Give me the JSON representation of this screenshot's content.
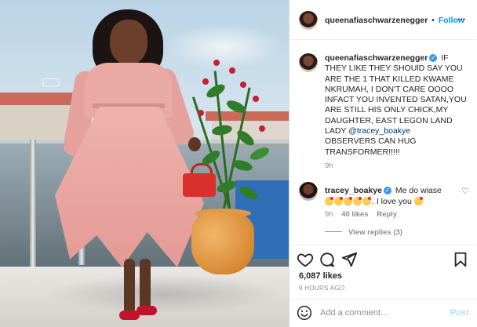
{
  "post": {
    "username": "queenafiaschwarzenegger",
    "separator": "•",
    "follow_label": "Follow",
    "more_label": "···"
  },
  "caption": {
    "username": "queenafiaschwarzenegger",
    "text_1": "IF THEY LIKE THEY SHOUlD SAY YOU ARE THE 1 THAT KILLED KWAME NKRUMAH, I DON'T CARE OOOO INFACT YOU INVENTED SATAN,YOU ARE STILL HIS ONLY CHICK,MY DAUGHTER, EAST LEGON LAND LADY",
    "mention": "@tracey_boakye",
    "text_2": "OBSERVERS CAN HUG TRANSFORMER!!!!!",
    "time": "9h"
  },
  "comment": {
    "username": "tracey_boakye",
    "text_1": "Me do wiase",
    "text_2": ". I love you",
    "time": "9h",
    "likes": "40 likes",
    "reply": "Reply",
    "view_replies": "View replies (3)"
  },
  "footer": {
    "likes": "6,087 likes",
    "timestamp": "9 HOURS AGO",
    "add_comment_placeholder": "Add a comment...",
    "post_label": "Post"
  },
  "icons": {
    "like": "heart-icon",
    "comment": "comment-icon",
    "share": "share-icon",
    "save": "bookmark-icon",
    "emoji": "smiley-icon",
    "verified": "verified-badge-icon"
  },
  "colors": {
    "accent": "#0095f6",
    "verified": "#3897f0",
    "mention": "#00376b",
    "muted": "#8e8e8e",
    "post_disabled": "#b2dffc"
  }
}
